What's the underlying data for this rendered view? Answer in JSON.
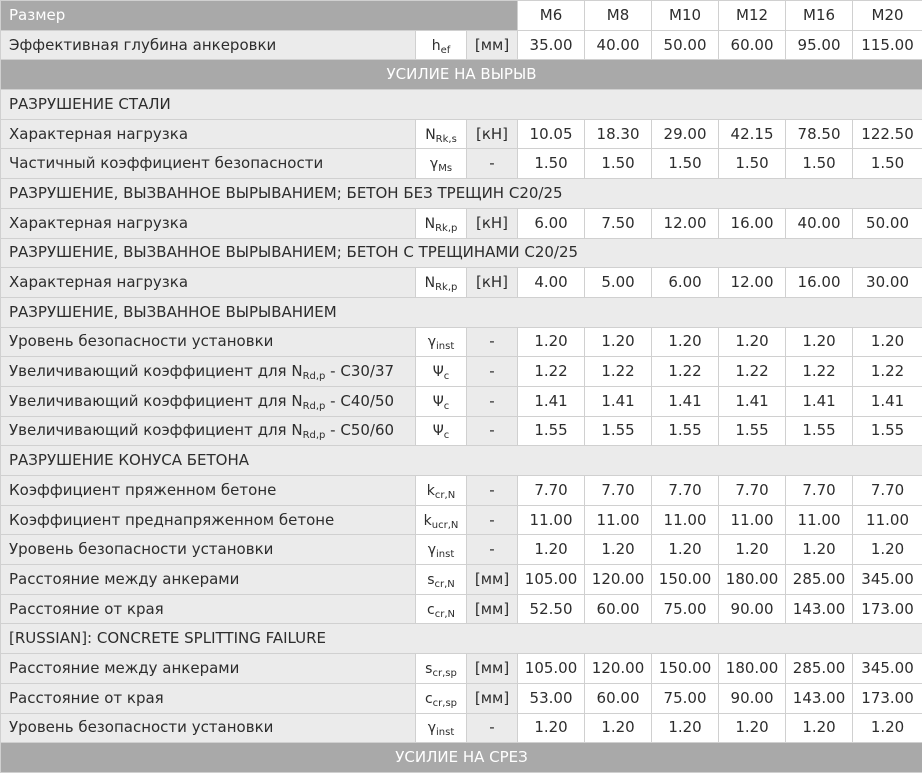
{
  "header": {
    "size_label": "Размер",
    "sizes": [
      "M6",
      "M8",
      "M10",
      "M12",
      "M16",
      "M20"
    ]
  },
  "rows": [
    {
      "kind": "data",
      "label": "Эффективная глубина анкеровки",
      "sym": "h",
      "sub": "ef",
      "unit": "[мм]",
      "values": [
        "35.00",
        "40.00",
        "50.00",
        "60.00",
        "95.00",
        "115.00"
      ]
    },
    {
      "kind": "banner",
      "text": "УСИЛИЕ НА ВЫРЫВ"
    },
    {
      "kind": "section",
      "text": "РАЗРУШЕНИЕ СТАЛИ"
    },
    {
      "kind": "data",
      "label": "Характерная нагрузка",
      "sym": "N",
      "sub": "Rk,s",
      "unit": "[кН]",
      "values": [
        "10.05",
        "18.30",
        "29.00",
        "42.15",
        "78.50",
        "122.50"
      ]
    },
    {
      "kind": "data",
      "label": "Частичный коэффициент безопасности",
      "sym": "γ",
      "sub": "Ms",
      "unit": "-",
      "values": [
        "1.50",
        "1.50",
        "1.50",
        "1.50",
        "1.50",
        "1.50"
      ]
    },
    {
      "kind": "section",
      "text": "РАЗРУШЕНИЕ, ВЫЗВАННОЕ ВЫРЫВАНИЕМ; БЕТОН БЕЗ ТРЕЩИН C20/25"
    },
    {
      "kind": "data",
      "label": "Характерная нагрузка",
      "sym": "N",
      "sub": "Rk,p",
      "unit": "[кН]",
      "values": [
        "6.00",
        "7.50",
        "12.00",
        "16.00",
        "40.00",
        "50.00"
      ]
    },
    {
      "kind": "section",
      "text": "РАЗРУШЕНИЕ, ВЫЗВАННОЕ ВЫРЫВАНИЕМ; БЕТОН С ТРЕЩИНАМИ C20/25"
    },
    {
      "kind": "data",
      "label": "Характерная нагрузка",
      "sym": "N",
      "sub": "Rk,p",
      "unit": "[кН]",
      "values": [
        "4.00",
        "5.00",
        "6.00",
        "12.00",
        "16.00",
        "30.00"
      ]
    },
    {
      "kind": "section",
      "text": "РАЗРУШЕНИЕ, ВЫЗВАННОЕ ВЫРЫВАНИЕМ"
    },
    {
      "kind": "data",
      "label": "Уровень безопасности установки",
      "sym": "γ",
      "sub": "inst",
      "unit": "-",
      "values": [
        "1.20",
        "1.20",
        "1.20",
        "1.20",
        "1.20",
        "1.20"
      ]
    },
    {
      "kind": "data",
      "label_pre": "Увеличивающий коэффициент для N",
      "label_sub": "Rd,p",
      "label_post": " - C30/37",
      "sym": "Ψ",
      "sub": "c",
      "unit": "-",
      "values": [
        "1.22",
        "1.22",
        "1.22",
        "1.22",
        "1.22",
        "1.22"
      ]
    },
    {
      "kind": "data",
      "label_pre": "Увеличивающий коэффициент для N",
      "label_sub": "Rd,p",
      "label_post": " - C40/50",
      "sym": "Ψ",
      "sub": "c",
      "unit": "-",
      "values": [
        "1.41",
        "1.41",
        "1.41",
        "1.41",
        "1.41",
        "1.41"
      ]
    },
    {
      "kind": "data",
      "label_pre": "Увеличивающий коэффициент для N",
      "label_sub": "Rd,p",
      "label_post": " - C50/60",
      "sym": "Ψ",
      "sub": "c",
      "unit": "-",
      "values": [
        "1.55",
        "1.55",
        "1.55",
        "1.55",
        "1.55",
        "1.55"
      ]
    },
    {
      "kind": "section",
      "text": "РАЗРУШЕНИЕ КОНУСА БЕТОНА"
    },
    {
      "kind": "data",
      "label": "Коэффициент пряженном бетоне",
      "sym": "k",
      "sub": "cr,N",
      "unit": "-",
      "values": [
        "7.70",
        "7.70",
        "7.70",
        "7.70",
        "7.70",
        "7.70"
      ]
    },
    {
      "kind": "data",
      "label": "Коэффициент преднапряженном бетоне",
      "sym": "k",
      "sub": "ucr,N",
      "unit": "-",
      "values": [
        "11.00",
        "11.00",
        "11.00",
        "11.00",
        "11.00",
        "11.00"
      ]
    },
    {
      "kind": "data",
      "label": "Уровень безопасности установки",
      "sym": "γ",
      "sub": "inst",
      "unit": "-",
      "values": [
        "1.20",
        "1.20",
        "1.20",
        "1.20",
        "1.20",
        "1.20"
      ]
    },
    {
      "kind": "data",
      "label": "Расстояние между анкерами",
      "sym": "s",
      "sub": "cr,N",
      "unit": "[мм]",
      "values": [
        "105.00",
        "120.00",
        "150.00",
        "180.00",
        "285.00",
        "345.00"
      ]
    },
    {
      "kind": "data",
      "label": "Расстояние от края",
      "sym": "c",
      "sub": "cr,N",
      "unit": "[мм]",
      "values": [
        "52.50",
        "60.00",
        "75.00",
        "90.00",
        "143.00",
        "173.00"
      ]
    },
    {
      "kind": "section",
      "text": "[RUSSIAN]: CONCRETE SPLITTING FAILURE"
    },
    {
      "kind": "data",
      "label": "Расстояние между анкерами",
      "sym": "s",
      "sub": "cr,sp",
      "unit": "[мм]",
      "values": [
        "105.00",
        "120.00",
        "150.00",
        "180.00",
        "285.00",
        "345.00"
      ]
    },
    {
      "kind": "data",
      "label": "Расстояние от края",
      "sym": "c",
      "sub": "cr,sp",
      "unit": "[мм]",
      "values": [
        "53.00",
        "60.00",
        "75.00",
        "90.00",
        "143.00",
        "173.00"
      ]
    },
    {
      "kind": "data",
      "label": "Уровень безопасности установки",
      "sym": "γ",
      "sub": "inst",
      "unit": "-",
      "values": [
        "1.20",
        "1.20",
        "1.20",
        "1.20",
        "1.20",
        "1.20"
      ]
    },
    {
      "kind": "banner",
      "text": "УСИЛИЕ НА СРЕЗ"
    }
  ]
}
